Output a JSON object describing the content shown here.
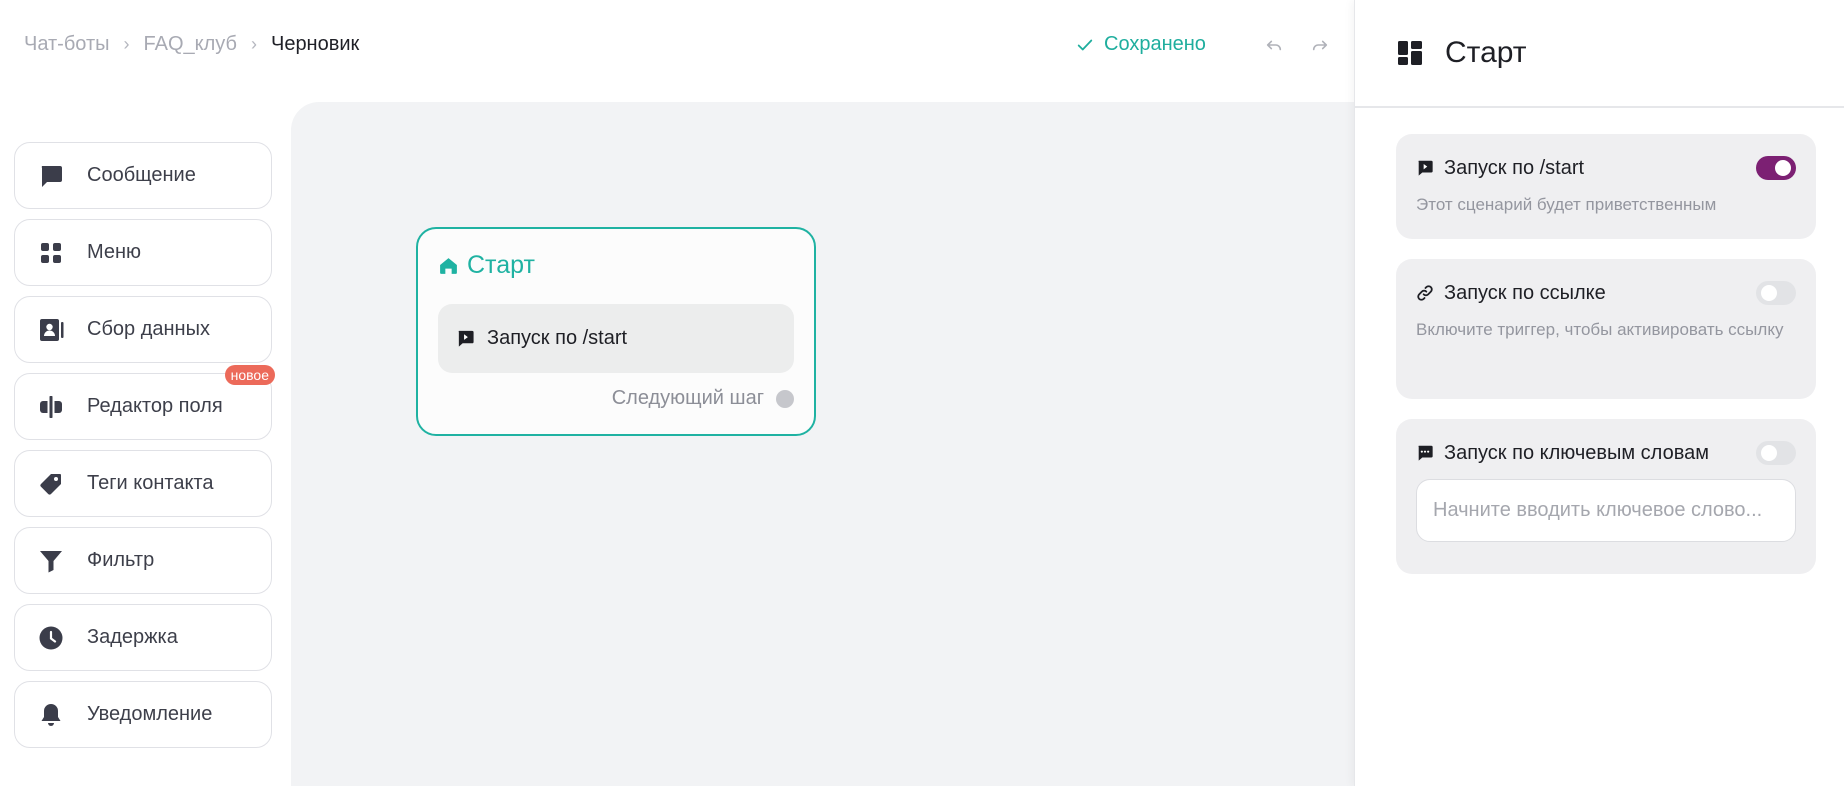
{
  "header": {
    "breadcrumb": [
      "Чат-боты",
      "FAQ_клуб",
      "Черновик"
    ],
    "status": "Сохранено",
    "undo_icon": "undo-icon",
    "redo_icon": "redo-icon"
  },
  "sidebar": {
    "items": [
      {
        "label": "Сообщение",
        "icon": "message-icon"
      },
      {
        "label": "Меню",
        "icon": "menu-grid-icon"
      },
      {
        "label": "Сбор данных",
        "icon": "contact-card-icon"
      },
      {
        "label": "Редактор поля",
        "icon": "field-editor-icon",
        "badge": "новое"
      },
      {
        "label": "Теги контакта",
        "icon": "tag-icon"
      },
      {
        "label": "Фильтр",
        "icon": "filter-icon"
      },
      {
        "label": "Задержка",
        "icon": "clock-icon"
      },
      {
        "label": "Уведомление",
        "icon": "bell-icon"
      }
    ]
  },
  "canvas": {
    "node": {
      "title": "Старт",
      "trigger": "Запуск по /start",
      "next_step": "Следующий шаг"
    }
  },
  "panel": {
    "title": "Старт",
    "cards": [
      {
        "title": "Запуск по /start",
        "description": "Этот сценарий будет приветственным",
        "enabled": true
      },
      {
        "title": "Запуск по ссылке",
        "description": "Включите триггер, чтобы активировать ссылку",
        "enabled": false
      },
      {
        "title": "Запуск по ключевым словам",
        "placeholder": "Начните вводить ключевое слово...",
        "value": "",
        "enabled": false
      }
    ]
  },
  "colors": {
    "accent_teal": "#1fb2a2",
    "toggle_on": "#7c2073",
    "badge": "#ec6a5a"
  }
}
